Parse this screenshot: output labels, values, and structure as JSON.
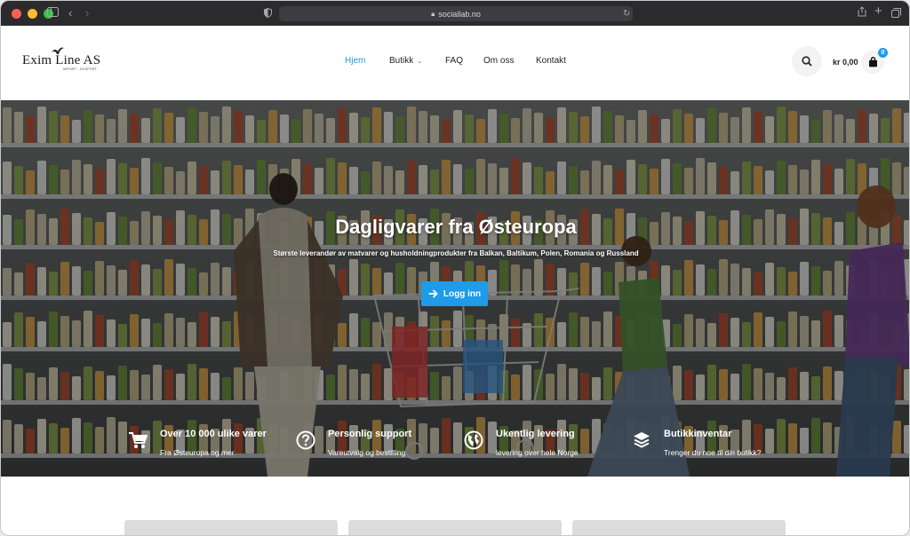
{
  "browser": {
    "url": "sociallab.no"
  },
  "header": {
    "logo_text": "Exim Line AS",
    "logo_sub": "IMPORT - EKSPORT",
    "nav": [
      {
        "label": "Hjem",
        "active": true
      },
      {
        "label": "Butikk",
        "has_dropdown": true
      },
      {
        "label": "FAQ"
      },
      {
        "label": "Om oss"
      },
      {
        "label": "Kontakt"
      }
    ],
    "cart_total": "kr 0,00",
    "cart_count": "0"
  },
  "hero": {
    "title": "Dagligvarer fra Østeuropa",
    "subtitle": "Største leverandør av matvarer og husholdningprodukter fra Balkan, Baltikum, Polen, Romania og Russland",
    "button_label": "Logg inn"
  },
  "features": [
    {
      "icon": "cart-icon",
      "title": "Over 10 000 ulike varer",
      "text": "Fra Østeuropa og mer"
    },
    {
      "icon": "question-icon",
      "title": "Personlig support",
      "text": "Vareutvalg og bestilling"
    },
    {
      "icon": "globe-icon",
      "title": "Ukentlig levering",
      "text": "levering over hele Norge"
    },
    {
      "icon": "layers-icon",
      "title": "Butikkinventar",
      "text": "Trenger du noe til din butikk?"
    }
  ],
  "colors": {
    "accent": "#1e9be9",
    "chrome": "#2b2b2e"
  }
}
